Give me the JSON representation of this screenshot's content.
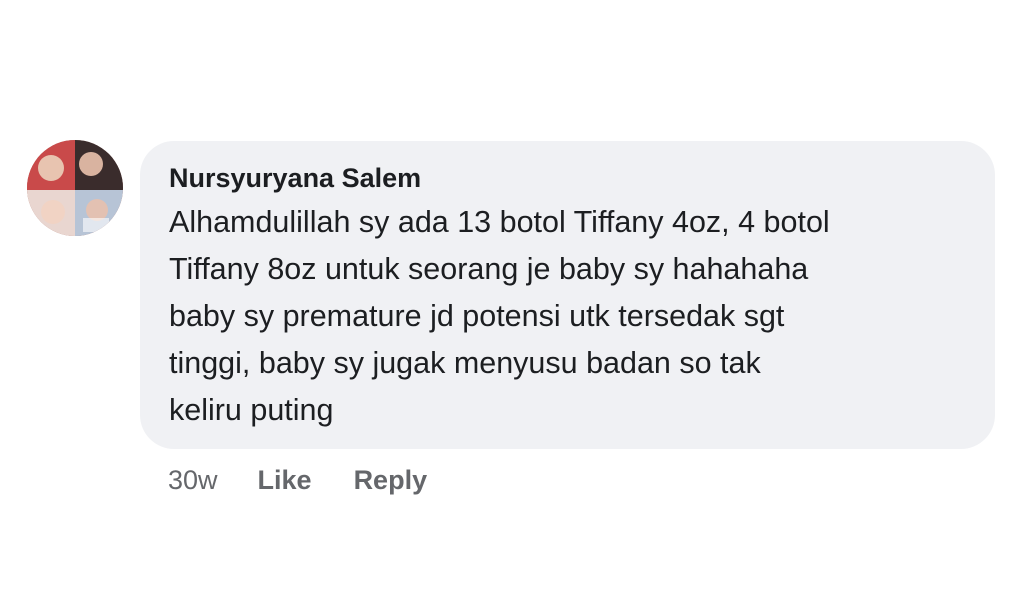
{
  "comment": {
    "author": "Nursyuryana Salem",
    "lines": [
      "Alhamdulillah sy ada 13 botol Tiffany 4oz, 4 botol",
      "Tiffany 8oz untuk seorang je baby sy hahahaha",
      "baby sy premature jd potensi utk tersedak sgt",
      "tinggi, baby sy jugak menyusu badan so tak",
      "keliru puting"
    ],
    "timestamp": "30w",
    "like_label": "Like",
    "reply_label": "Reply"
  },
  "colors": {
    "bubble_bg": "#f0f1f4",
    "text": "#1c1e21",
    "meta": "#65676b"
  }
}
